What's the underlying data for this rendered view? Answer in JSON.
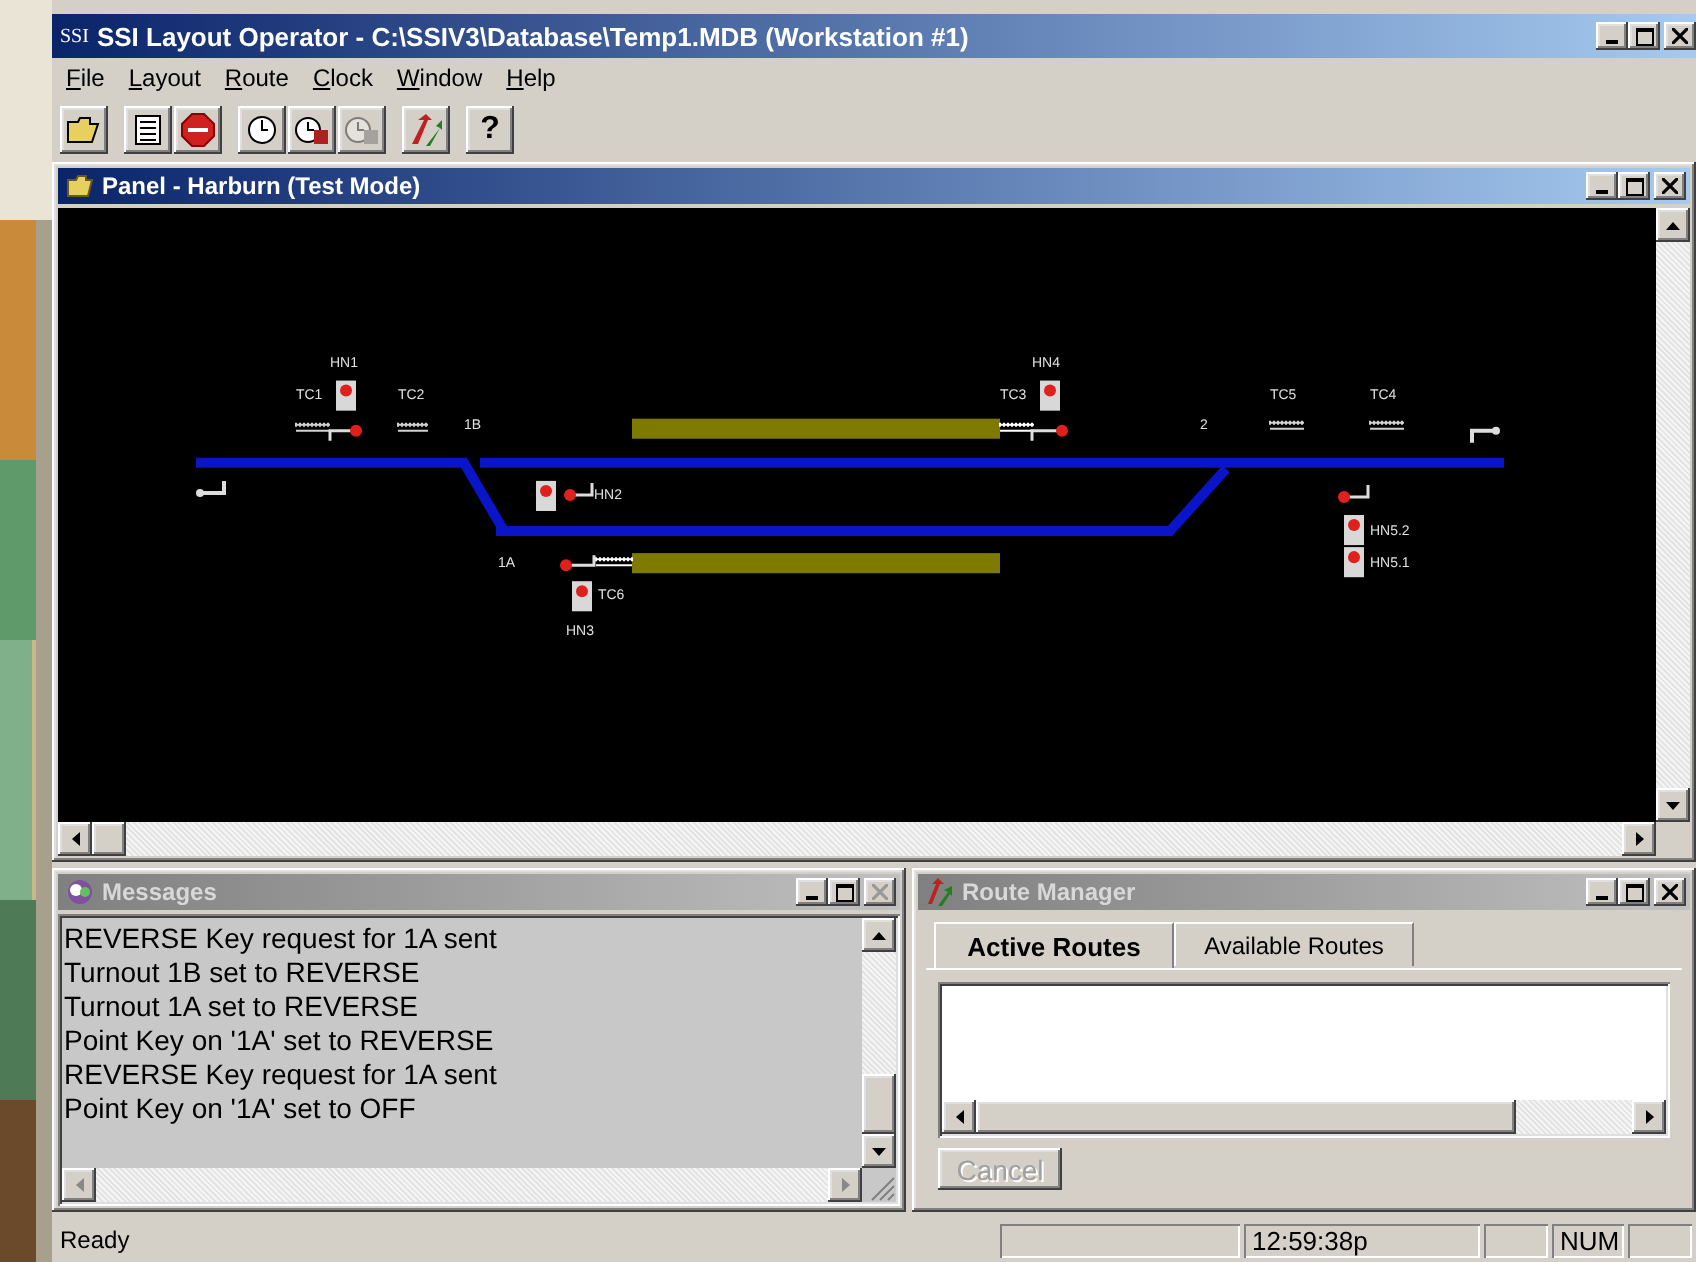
{
  "window": {
    "badge": "SSI",
    "title": "SSI Layout Operator - C:\\SSIV3\\Database\\Temp1.MDB (Workstation #1)"
  },
  "menu": [
    "File",
    "Layout",
    "Route",
    "Clock",
    "Window",
    "Help"
  ],
  "toolbar": [
    [
      {
        "kind": "open",
        "disabled": false
      }
    ],
    [
      {
        "kind": "list",
        "disabled": false
      },
      {
        "kind": "stop",
        "disabled": false
      }
    ],
    [
      {
        "kind": "clock",
        "disabled": false
      },
      {
        "kind": "clock-run",
        "disabled": false
      },
      {
        "kind": "clock-stop",
        "disabled": true
      }
    ],
    [
      {
        "kind": "route",
        "disabled": false
      }
    ],
    [
      {
        "kind": "help",
        "glyph": "?",
        "disabled": false
      }
    ]
  ],
  "panel": {
    "title": "Panel - Harburn (Test Mode)",
    "active": true,
    "signals": [
      "HN1",
      "HN4",
      "HN2",
      "HN3",
      "HN5.2",
      "HN5.1"
    ],
    "track_circuits": [
      {
        "label": "TC1",
        "occupied": false
      },
      {
        "label": "TC2",
        "occupied": false
      },
      {
        "label": "TC3",
        "occupied": true
      },
      {
        "label": "TC5",
        "occupied": false
      },
      {
        "label": "TC4",
        "occupied": false
      },
      {
        "label": "TC6",
        "occupied": true
      }
    ],
    "turnouts": [
      "1B",
      "1A",
      "2"
    ]
  },
  "messages": {
    "title": "Messages",
    "active": false,
    "lines": [
      "REVERSE Key request for 1A sent",
      "Turnout 1B set to REVERSE",
      "Turnout 1A set to REVERSE",
      "Point Key on '1A' set to REVERSE",
      "REVERSE Key request for 1A sent",
      "Point Key on '1A' set to OFF"
    ]
  },
  "route_manager": {
    "title": "Route Manager",
    "active": false,
    "tabs": [
      {
        "label": "Active Routes",
        "selected": true
      },
      {
        "label": "Available Routes",
        "selected": false
      }
    ],
    "cancel": {
      "label": "Cancel",
      "disabled": true
    }
  },
  "status_bar": {
    "text": "Ready",
    "time": "12:59:38p",
    "num": "NUM"
  }
}
